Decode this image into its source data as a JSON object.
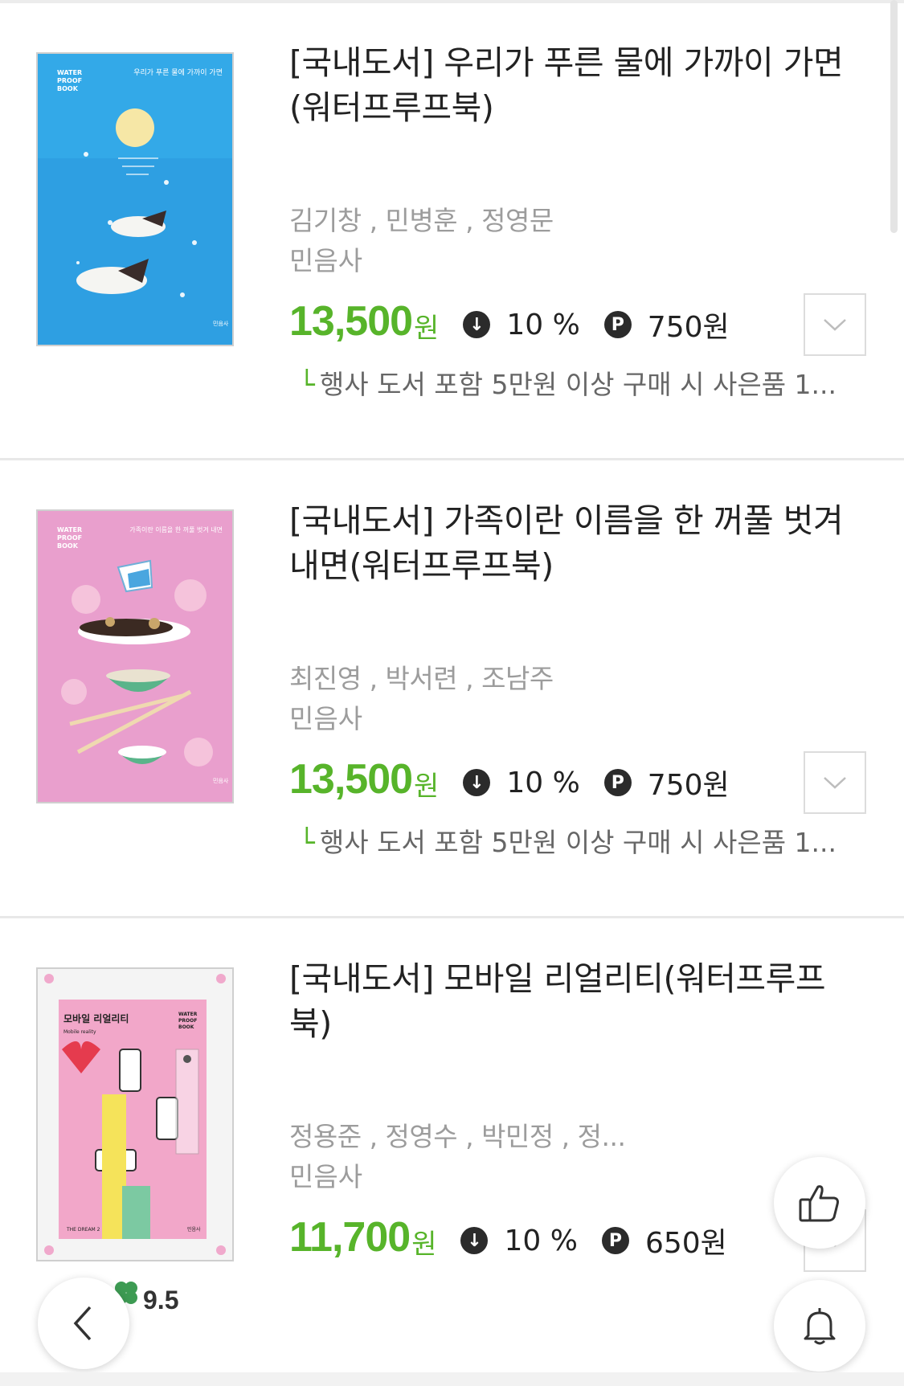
{
  "items": [
    {
      "title": "[국내도서] 우리가 푸른 물에 가까이 가면(워터프루프북)",
      "authors": "김기창 , 민병훈 , 정영문",
      "publisher": "민음사",
      "price": "13,500",
      "won": "원",
      "discount": "10 %",
      "point": "750원",
      "promo": "행사 도서 포함 5만원 이상 구매 시 사은품 1...",
      "cover": {
        "brand": "WATER PROOF BOOK",
        "title": "우리가 푸른 물에 가까이 가면",
        "publisher_mark": "민음사",
        "bg_color": "#33a9e8"
      }
    },
    {
      "title": "[국내도서] 가족이란 이름을 한 꺼풀 벗겨 내면(워터프루프북)",
      "authors": "최진영 , 박서련 , 조남주",
      "publisher": "민음사",
      "price": "13,500",
      "won": "원",
      "discount": "10 %",
      "point": "750원",
      "promo": "행사 도서 포함 5만원 이상 구매 시 사은품 1...",
      "cover": {
        "brand": "WATER PROOF BOOK",
        "title": "가족이란 이름을 한 꺼풀 벗겨 내면",
        "publisher_mark": "민음사",
        "bg_color": "#e99fcd"
      }
    },
    {
      "title": "[국내도서] 모바일 리얼리티(워터프루프북)",
      "authors": "정용준 , 정영수 , 박민정 , 정...",
      "publisher": "민음사",
      "price": "11,700",
      "won": "원",
      "discount": "10 %",
      "point": "650원",
      "rating": "9.5",
      "cover": {
        "brand": "WATER PROOF BOOK",
        "title": "모바일 리얼리티",
        "subtitle": "Mobile reality",
        "footer": "THE DREAM 2",
        "publisher_mark": "민음사",
        "bg_color": "#f2a7c9"
      }
    }
  ],
  "icons": {
    "discount": "down-arrow-circle-icon",
    "point": "point-p-icon",
    "dropdown": "chevron-down-icon",
    "like": "thumbs-up-icon",
    "alarm": "bell-icon",
    "back": "chevron-left-icon"
  },
  "colors": {
    "price": "#57b42a",
    "meta": "#9c9c9c"
  }
}
